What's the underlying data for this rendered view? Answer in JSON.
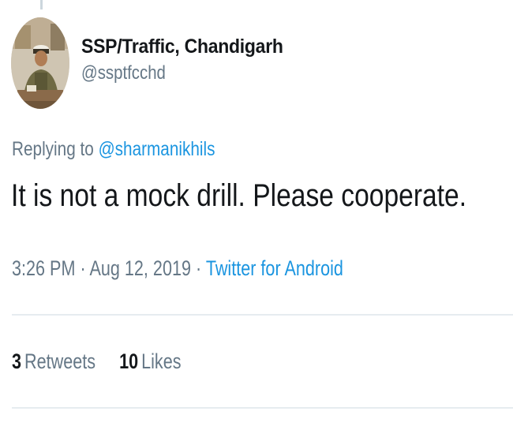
{
  "user": {
    "display_name": "SSP/Traffic, Chandigarh",
    "handle": "@ssptfcchd",
    "avatar_icon": "profile-photo"
  },
  "reply": {
    "prefix": "Replying to",
    "mention": "@sharmanikhils"
  },
  "tweet": {
    "text": "It is not a mock drill. Please cooperate."
  },
  "meta": {
    "time": "3:26 PM",
    "date": "Aug 12, 2019",
    "separator": "·",
    "source": "Twitter for Android"
  },
  "stats": {
    "retweets_count": "3",
    "retweets_label": "Retweets",
    "likes_count": "10",
    "likes_label": "Likes"
  },
  "colors": {
    "link": "#1b95e0",
    "muted": "#657786",
    "text": "#14171a",
    "divider": "#e6ecf0"
  }
}
